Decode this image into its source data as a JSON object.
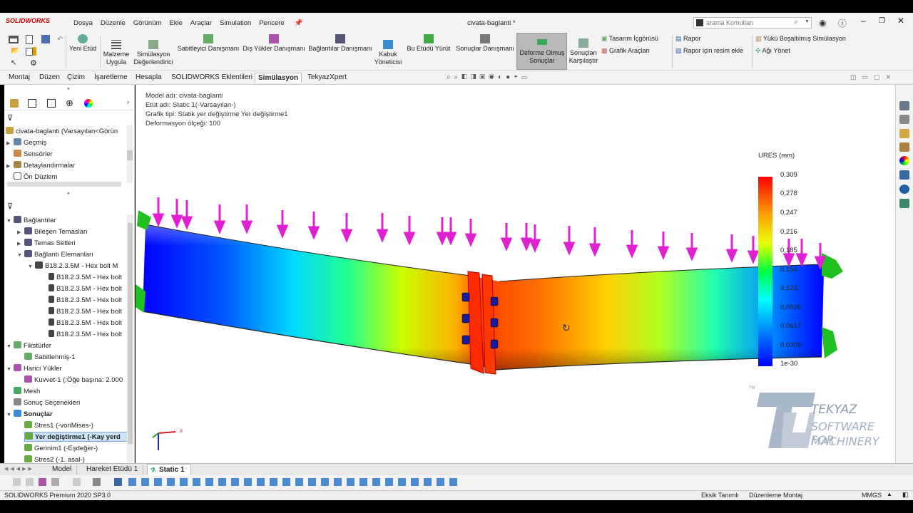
{
  "app": {
    "logo_text": "SOLIDWORKS",
    "doc_title": "civata-baglanti *"
  },
  "menu": [
    "Dosya",
    "Düzenle",
    "Görünüm",
    "Ekle",
    "Araçlar",
    "Simulation",
    "Pencere"
  ],
  "search": {
    "placeholder": "arama Komutları"
  },
  "ribbon": {
    "yeni_etud": "Yeni Etüd",
    "malzeme": "Malzeme Uygula",
    "sim_deg": "Simülasyon Değerlendirici",
    "sabit": "Sabitleyici Danışmanı",
    "dis_yuk": "Dış Yükler Danışmanı",
    "bag": "Bağlantılar Danışmanı",
    "kabuk": "Kabuk Yöneticisi",
    "yurut": "Bu Etüdü Yürüt",
    "sonuc_dan": "Sonuçlar Danışmanı",
    "deforme": "Deforme Olmuş Sonuçlar",
    "karsilastir": "Sonuçları Karşılaştır",
    "tasarim": "Tasarım İçgörüsü",
    "grafik": "Grafik Araçları",
    "rapor": "Rapor",
    "rapor_resim": "Rapor için resim ekle",
    "yuku_bosalt": "Yükü Boşaltılmış Simülasyon",
    "ag": "Ağı Yönet"
  },
  "tabs": [
    "Montaj",
    "Düzen",
    "Çizim",
    "İşaretleme",
    "Hesapla",
    "SOLIDWORKS Eklentileri",
    "Simülasyon",
    "TekyazXpert"
  ],
  "active_tab": "Simülasyon",
  "tree_top": {
    "root": "civata-baglanti  (Varsayılan<Görün",
    "items": [
      "Geçmiş",
      "Sensörler",
      "Detaylandırmalar",
      "Ön Düzlem"
    ]
  },
  "tree_sim": {
    "baglantilar": "Bağlantılar",
    "bilesen": "Bileşen Temasları",
    "temas": "Temas Setleri",
    "bag_el": "Bağlantı Elemanları",
    "bolt_parent": "B18.2.3.5M - Hex bolt M",
    "bolt_child": "B18.2.3.5M - Hex bolt",
    "fiksturler": "Fikstürler",
    "sabit": "Sabitlenmiş-1",
    "harici": "Harici Yükler",
    "kuvvet": "Kuvvet-1 (:Öğe başına: 2.000",
    "mesh": "Mesh",
    "sonuc_sec": "Sonuç Seçenekleri",
    "sonuclar": "Sonuçlar",
    "stres1": "Stres1 (-vonMises-)",
    "yer": "Yer değiştirme1 (-Kay yerd",
    "gerinim": "Gerinim1 (-Eşdeğer-)",
    "stres2": "Stres2 (-1. asal-)"
  },
  "plot_info": {
    "model": "Model adı: civata-baglanti",
    "etud": "Etüt adı: Static 1(-Varsayılan-)",
    "grafik": "Grafik tipi: Statik yer değiştirme Yer değiştirme1",
    "def": "Deformasyon ölçeği: 100"
  },
  "legend": {
    "title": "URES (mm)",
    "labels": [
      "0,309",
      "0,278",
      "0,247",
      "0,216",
      "0,185",
      "0,154",
      "0,123",
      "0,0926",
      "0,0617",
      "0,0309",
      "1e-30"
    ]
  },
  "watermark": {
    "tm": "TM",
    "brand": "TEKYAZ",
    "line1": "SOFTWARE FOR",
    "line2": "MACHINERY"
  },
  "triad": {
    "x": "x"
  },
  "bottom_tabs": [
    "Model",
    "Hareket Etüdü 1",
    "Static 1"
  ],
  "status": {
    "app": "SOLIDWORKS Premium 2020 SP3.0",
    "eksik": "Eksik Tanımlı",
    "duzen": "Düzenleme Montaj",
    "units": "MMGS"
  }
}
